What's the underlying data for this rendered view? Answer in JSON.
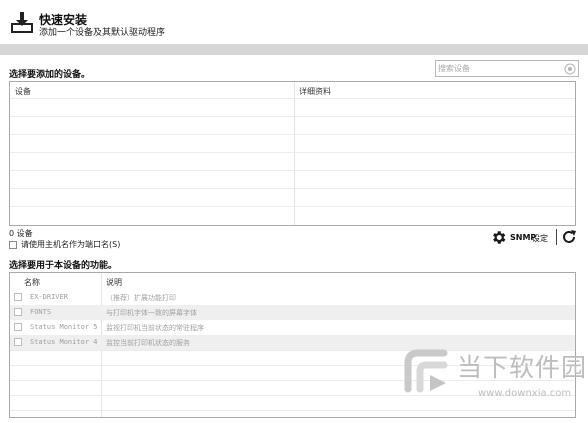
{
  "header": {
    "title": "快速安装",
    "subtitle": "添加一个设备及其默认驱动程序",
    "icon": "download-tray-icon"
  },
  "device_section": {
    "label": "选择要添加的设备。",
    "search_placeholder": "搜索设备",
    "columns": [
      "设备",
      "详细资料"
    ],
    "rows": [],
    "count_text": "0 设备",
    "use_host_name_option": "请使用主机名作为端口名(S)",
    "use_host_name_checked": false
  },
  "snmp": {
    "label": "SNMP",
    "settings_label": "设定",
    "gear_icon": "gear-icon",
    "refresh_icon": "refresh-icon"
  },
  "function_section": {
    "label": "选择要用于本设备的功能。",
    "columns": [
      "名称",
      "说明"
    ],
    "rows": [
      {
        "name": "EX-DRIVER",
        "description": "（推荐）扩展功能打印",
        "checked": false,
        "enabled": false
      },
      {
        "name": "FONTS",
        "description": "与打印机字体一致的屏幕字体",
        "checked": false,
        "enabled": false
      },
      {
        "name": "Status Monitor 5",
        "description": "监视打印机当前状态的常驻程序",
        "checked": false,
        "enabled": false
      },
      {
        "name": "Status Monitor 4",
        "description": "监控当前打印机状态的服务",
        "checked": false,
        "enabled": false
      }
    ]
  },
  "watermark": {
    "text": "当下软件园",
    "url": "www.downxia.com"
  },
  "colors": {
    "header_rule": "#d6d6d6",
    "border": "#a9a9a9",
    "shaded_row": "#efefef",
    "watermark": "#bdbdbd"
  }
}
